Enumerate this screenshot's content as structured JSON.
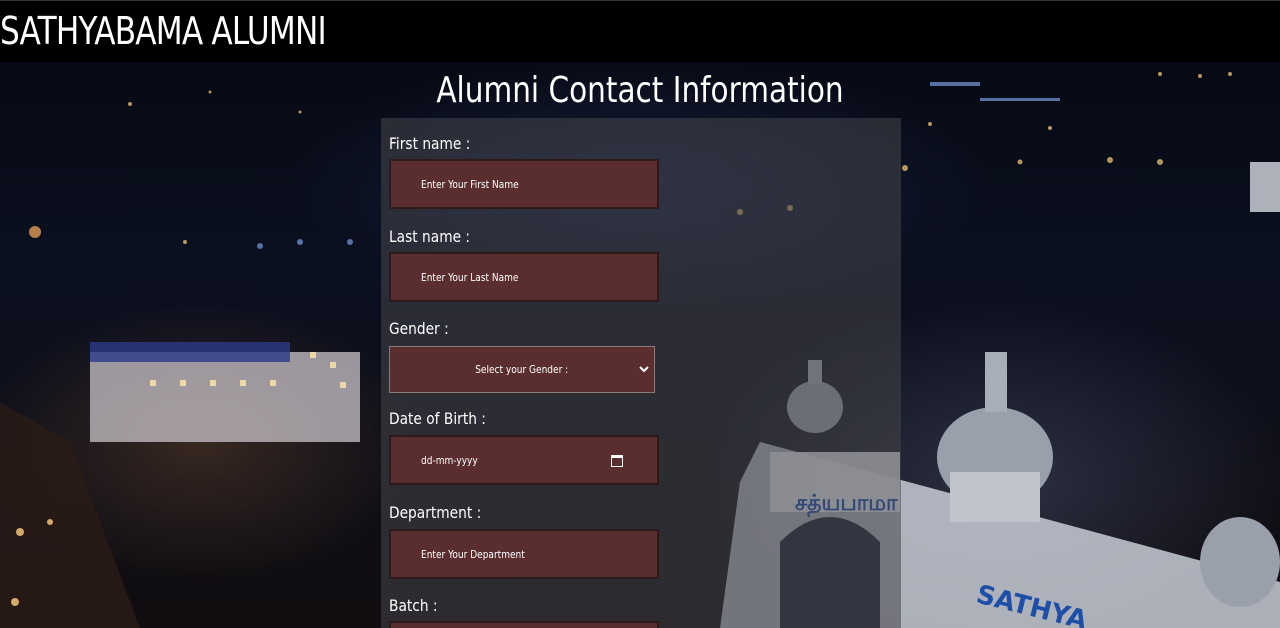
{
  "header": {
    "brand": "SATHYABAMA ALUMNI"
  },
  "page": {
    "title": "Alumni Contact Information"
  },
  "form": {
    "first_name": {
      "label": "First name :",
      "placeholder": "Enter Your First Name"
    },
    "last_name": {
      "label": "Last name :",
      "placeholder": "Enter Your Last Name"
    },
    "gender": {
      "label": "Gender :",
      "selected": "Select your Gender :"
    },
    "dob": {
      "label": "Date of Birth :",
      "placeholder": "dd-mm-yyyy"
    },
    "department": {
      "label": "Department :",
      "placeholder": "Enter Your Department"
    },
    "batch": {
      "label": "Batch :"
    }
  },
  "colors": {
    "field_bg": "#5a2e2f",
    "panel_bg": "rgba(70,70,75,0.55)",
    "topbar_bg": "#000000"
  },
  "icons": {
    "select": "chevron-down-icon",
    "date": "calendar-icon"
  }
}
